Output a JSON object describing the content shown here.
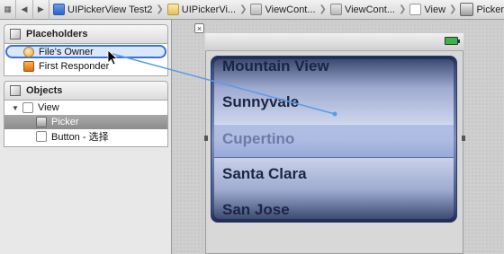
{
  "jumpbar": {
    "crumbs": [
      {
        "label": "UIPickerView Test2",
        "icon": "project-icon"
      },
      {
        "label": "UIPickerVi...",
        "icon": "folder-icon"
      },
      {
        "label": "ViewCont...",
        "icon": "xib-icon"
      },
      {
        "label": "ViewCont...",
        "icon": "xib-icon"
      },
      {
        "label": "View",
        "icon": "view-icon"
      },
      {
        "label": "Picker",
        "icon": "picker-icon"
      }
    ]
  },
  "outline": {
    "placeholders": {
      "title": "Placeholders",
      "items": [
        {
          "label": "File's Owner",
          "icon": "files-owner-icon"
        },
        {
          "label": "First Responder",
          "icon": "first-responder-icon"
        }
      ]
    },
    "objects": {
      "title": "Objects",
      "items": [
        {
          "label": "View",
          "icon": "view-icon",
          "expanded": true
        },
        {
          "label": "Picker",
          "icon": "picker-icon",
          "selected": true
        },
        {
          "label": "Button - 选择",
          "icon": "button-icon"
        }
      ]
    }
  },
  "canvas": {
    "picker_rows": [
      "Mountain View",
      "Sunnyvale",
      "Cupertino",
      "Santa Clara",
      "San Jose"
    ],
    "selected_row": "Cupertino",
    "colors": {
      "accent": "#3a73d6",
      "picker_dark": "#1b2b55",
      "picker_light": "#dfe5f5"
    }
  }
}
